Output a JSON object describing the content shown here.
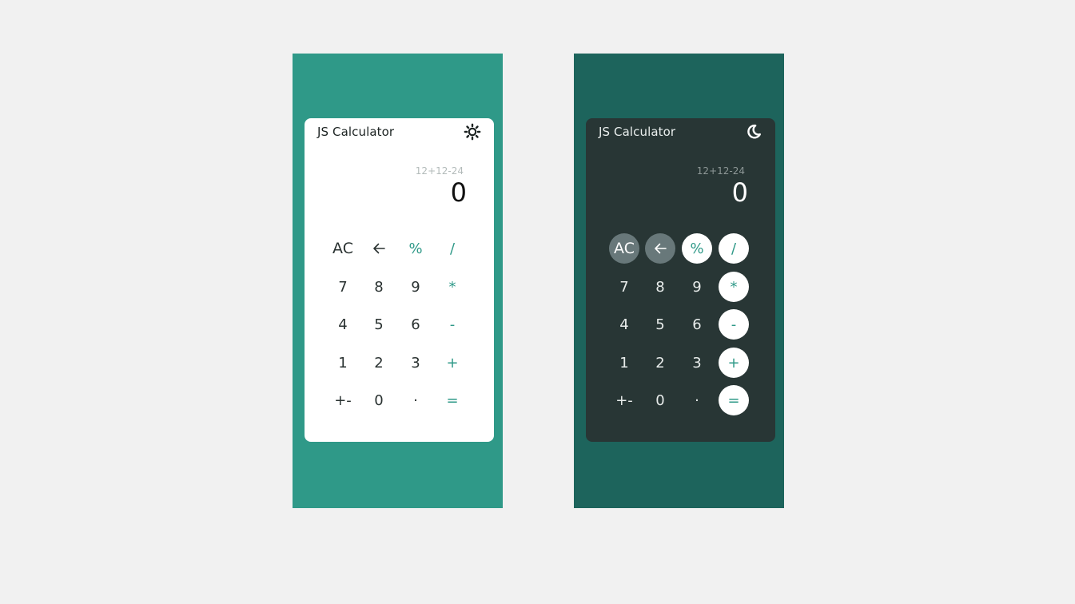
{
  "colors": {
    "page_background": "#f1f1f1",
    "light_panel": "#2f9988",
    "dark_panel": "#1d645c",
    "light_card": "#ffffff",
    "dark_card": "#283635",
    "accent": "#2f9988",
    "dark_function_button": "#68787a"
  },
  "light": {
    "title": "JS Calculator",
    "theme_icon": "sun-icon",
    "history": "12+12-24",
    "result": "0",
    "keys": {
      "ac": "AC",
      "backspace_icon": "arrow-left-icon",
      "percent": "%",
      "divide": "/",
      "seven": "7",
      "eight": "8",
      "nine": "9",
      "multiply": "*",
      "four": "4",
      "five": "5",
      "six": "6",
      "minus": "-",
      "one": "1",
      "two": "2",
      "three": "3",
      "plus": "+",
      "sign": "+-",
      "zero": "0",
      "decimal": "·",
      "equals": "="
    }
  },
  "dark": {
    "title": "JS Calculator",
    "theme_icon": "moon-icon",
    "history": "12+12-24",
    "result": "0",
    "keys": {
      "ac": "AC",
      "backspace_icon": "arrow-left-icon",
      "percent": "%",
      "divide": "/",
      "seven": "7",
      "eight": "8",
      "nine": "9",
      "multiply": "*",
      "four": "4",
      "five": "5",
      "six": "6",
      "minus": "-",
      "one": "1",
      "two": "2",
      "three": "3",
      "plus": "+",
      "sign": "+-",
      "zero": "0",
      "decimal": "·",
      "equals": "="
    }
  }
}
